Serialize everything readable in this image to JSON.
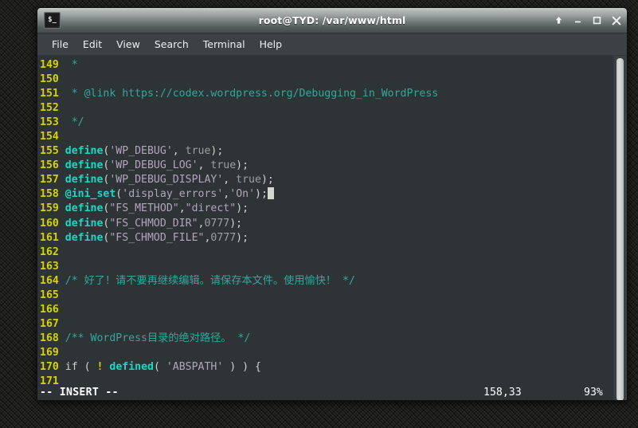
{
  "window": {
    "title": "root@TYD: /var/www/html",
    "icon_name": "terminal-icon",
    "icon_glyph": "$_",
    "controls": [
      {
        "name": "shade-button",
        "glyph": "↑"
      },
      {
        "name": "minimize-button",
        "glyph": "–"
      },
      {
        "name": "maximize-button",
        "glyph": "□"
      },
      {
        "name": "close-button",
        "glyph": "✕"
      }
    ]
  },
  "menubar": {
    "items": [
      {
        "label": "File"
      },
      {
        "label": "Edit"
      },
      {
        "label": "View"
      },
      {
        "label": "Search"
      },
      {
        "label": "Terminal"
      },
      {
        "label": "Help"
      }
    ]
  },
  "editor": {
    "first_line": 149,
    "lines": [
      {
        "no": "149",
        "segments": [
          {
            "t": " *",
            "c": "cmt"
          }
        ]
      },
      {
        "no": "150",
        "segments": []
      },
      {
        "no": "151",
        "segments": [
          {
            "t": " * @link https://codex.wordpress.org/Debugging_in_WordPress",
            "c": "cmt"
          }
        ]
      },
      {
        "no": "152",
        "segments": []
      },
      {
        "no": "153",
        "segments": [
          {
            "t": " */",
            "c": "cmt"
          }
        ]
      },
      {
        "no": "154",
        "segments": []
      },
      {
        "no": "155",
        "segments": [
          {
            "t": "define",
            "c": "kw"
          },
          {
            "t": "(",
            "c": "pun"
          },
          {
            "t": "'WP_DEBUG'",
            "c": "str"
          },
          {
            "t": ", ",
            "c": "pun"
          },
          {
            "t": "true",
            "c": "val"
          },
          {
            "t": ");",
            "c": "pun"
          }
        ]
      },
      {
        "no": "156",
        "segments": [
          {
            "t": "define",
            "c": "kw"
          },
          {
            "t": "(",
            "c": "pun"
          },
          {
            "t": "'WP_DEBUG_LOG'",
            "c": "str"
          },
          {
            "t": ", ",
            "c": "pun"
          },
          {
            "t": "true",
            "c": "val"
          },
          {
            "t": ");",
            "c": "pun"
          }
        ]
      },
      {
        "no": "157",
        "segments": [
          {
            "t": "define",
            "c": "kw"
          },
          {
            "t": "(",
            "c": "pun"
          },
          {
            "t": "'WP_DEBUG_DISPLAY'",
            "c": "str"
          },
          {
            "t": ", ",
            "c": "pun"
          },
          {
            "t": "true",
            "c": "val"
          },
          {
            "t": ");",
            "c": "pun"
          }
        ]
      },
      {
        "no": "158",
        "segments": [
          {
            "t": "@ini_set",
            "c": "kw"
          },
          {
            "t": "(",
            "c": "pun"
          },
          {
            "t": "'display_errors'",
            "c": "str"
          },
          {
            "t": ",",
            "c": "pun"
          },
          {
            "t": "'On'",
            "c": "str"
          },
          {
            "t": ");",
            "c": "pun"
          }
        ],
        "cursor": true
      },
      {
        "no": "159",
        "segments": [
          {
            "t": "define",
            "c": "kw"
          },
          {
            "t": "(",
            "c": "pun"
          },
          {
            "t": "\"FS_METHOD\"",
            "c": "str"
          },
          {
            "t": ",",
            "c": "pun"
          },
          {
            "t": "\"direct\"",
            "c": "str"
          },
          {
            "t": ");",
            "c": "pun"
          }
        ]
      },
      {
        "no": "160",
        "segments": [
          {
            "t": "define",
            "c": "kw"
          },
          {
            "t": "(",
            "c": "pun"
          },
          {
            "t": "\"FS_CHMOD_DIR\"",
            "c": "str"
          },
          {
            "t": ",",
            "c": "pun"
          },
          {
            "t": "0777",
            "c": "val"
          },
          {
            "t": ");",
            "c": "pun"
          }
        ]
      },
      {
        "no": "161",
        "segments": [
          {
            "t": "define",
            "c": "kw"
          },
          {
            "t": "(",
            "c": "pun"
          },
          {
            "t": "\"FS_CHMOD_FILE\"",
            "c": "str"
          },
          {
            "t": ",",
            "c": "pun"
          },
          {
            "t": "0777",
            "c": "val"
          },
          {
            "t": ");",
            "c": "pun"
          }
        ]
      },
      {
        "no": "162",
        "segments": []
      },
      {
        "no": "163",
        "segments": []
      },
      {
        "no": "164",
        "segments": [
          {
            "t": "/* 好了！请不要再继续编辑。请保存本文件。使用愉快！ */",
            "c": "cn"
          }
        ]
      },
      {
        "no": "165",
        "segments": []
      },
      {
        "no": "166",
        "segments": []
      },
      {
        "no": "167",
        "segments": []
      },
      {
        "no": "168",
        "segments": [
          {
            "t": "/** WordPress目录的绝对路径。 */",
            "c": "cn"
          }
        ]
      },
      {
        "no": "169",
        "segments": []
      },
      {
        "no": "170",
        "segments": [
          {
            "t": "if ",
            "c": "ifk"
          },
          {
            "t": "( ",
            "c": "pun"
          },
          {
            "t": "!",
            "c": "bang"
          },
          {
            "t": " ",
            "c": "pun"
          },
          {
            "t": "defined",
            "c": "kw"
          },
          {
            "t": "( ",
            "c": "pun"
          },
          {
            "t": "'ABSPATH'",
            "c": "str"
          },
          {
            "t": " ) ) {",
            "c": "pun"
          }
        ]
      },
      {
        "no": "171",
        "segments": []
      }
    ]
  },
  "statusline": {
    "mode": "-- INSERT --",
    "position": "158,33",
    "percent": "93%"
  },
  "colors": {
    "terminal_background": "#2e3436",
    "line_number": "#d7d300",
    "comment": "#31a89c",
    "keyword": "#1fd6c6",
    "string": "#b4a3bd",
    "plain": "#cfd3cd",
    "titlebar_top": "#c6cac9",
    "titlebar_bottom": "#454e4e",
    "menubar": "#3c4243"
  }
}
